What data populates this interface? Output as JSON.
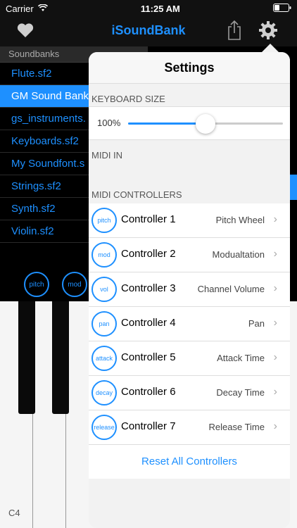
{
  "status": {
    "carrier": "Carrier",
    "time": "11:25 AM"
  },
  "nav": {
    "title": "iSoundBank"
  },
  "sidebar": {
    "header": "Soundbanks",
    "items": [
      {
        "label": "Flute.sf2"
      },
      {
        "label": "GM Sound Bank"
      },
      {
        "label": "gs_instruments."
      },
      {
        "label": "Keyboards.sf2"
      },
      {
        "label": "My Soundfont.s"
      },
      {
        "label": "Strings.sf2"
      },
      {
        "label": "Synth.sf2"
      },
      {
        "label": "Violin.sf2"
      }
    ],
    "selected_index": 1
  },
  "knobs": [
    {
      "label": "pitch"
    },
    {
      "label": "mod"
    }
  ],
  "piano": {
    "label": "C4"
  },
  "settings": {
    "title": "Settings",
    "keyboard_size_label": "KEYBOARD SIZE",
    "keyboard_size_value": "100%",
    "keyboard_slider_fraction": 0.5,
    "midi_in_label": "MIDI IN",
    "midi_controllers_label": "MIDI CONTROLLERS",
    "controllers": [
      {
        "knob": "pitch",
        "name": "Controller 1",
        "value": "Pitch Wheel"
      },
      {
        "knob": "mod",
        "name": "Controller 2",
        "value": "Modualtation"
      },
      {
        "knob": "vol",
        "name": "Controller 3",
        "value": "Channel Volume"
      },
      {
        "knob": "pan",
        "name": "Controller 4",
        "value": "Pan"
      },
      {
        "knob": "attack",
        "name": "Controller 5",
        "value": "Attack Time"
      },
      {
        "knob": "decay",
        "name": "Controller 6",
        "value": "Decay Time"
      },
      {
        "knob": "release",
        "name": "Controller 7",
        "value": "Release Time"
      }
    ],
    "reset_label": "Reset All Controllers"
  },
  "colors": {
    "accent": "#1e90ff"
  }
}
